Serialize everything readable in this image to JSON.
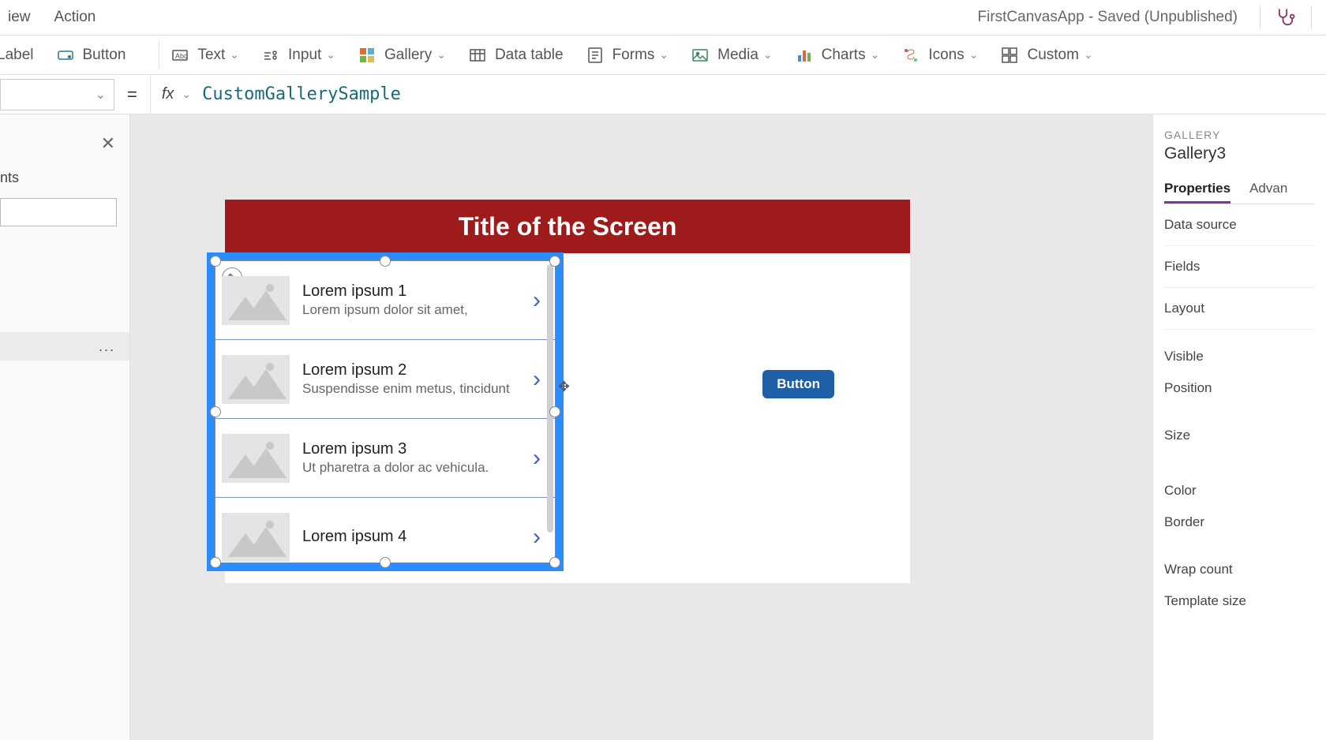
{
  "topbar": {
    "menu_view": "iew",
    "menu_action": "Action",
    "app_status": "FirstCanvasApp - Saved (Unpublished)"
  },
  "ribbon": {
    "label": "Label",
    "button": "Button",
    "text": "Text",
    "input": "Input",
    "gallery": "Gallery",
    "data_table": "Data table",
    "forms": "Forms",
    "media": "Media",
    "charts": "Charts",
    "icons": "Icons",
    "custom": "Custom"
  },
  "fx": {
    "equals": "=",
    "fx_label": "fx",
    "formula": "CustomGallerySample"
  },
  "left": {
    "tree_label": "nts",
    "row_more": "..."
  },
  "canvas": {
    "header_title": "Title of the Screen",
    "button_label": "Button",
    "gallery_items": [
      {
        "title": "Lorem ipsum 1",
        "subtitle": "Lorem ipsum dolor sit amet,"
      },
      {
        "title": "Lorem ipsum 2",
        "subtitle": "Suspendisse enim metus, tincidunt"
      },
      {
        "title": "Lorem ipsum 3",
        "subtitle": "Ut pharetra a dolor ac vehicula."
      },
      {
        "title": "Lorem ipsum 4",
        "subtitle": ""
      }
    ]
  },
  "right": {
    "section_label": "GALLERY",
    "control_name": "Gallery3",
    "tab_properties": "Properties",
    "tab_advanced": "Advan",
    "rows": {
      "data_source": "Data source",
      "fields": "Fields",
      "layout": "Layout",
      "visible": "Visible",
      "position": "Position",
      "size": "Size",
      "color": "Color",
      "border": "Border",
      "wrap_count": "Wrap count",
      "template_size": "Template size"
    }
  }
}
